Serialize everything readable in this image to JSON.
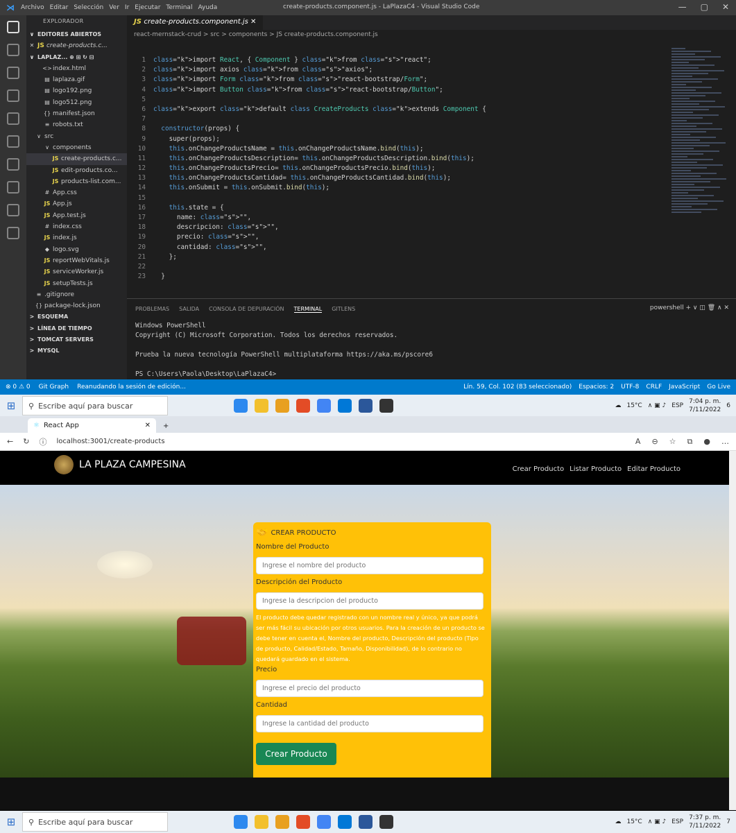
{
  "vscode": {
    "menu": [
      "Archivo",
      "Editar",
      "Selección",
      "Ver",
      "Ir",
      "Ejecutar",
      "Terminal",
      "Ayuda"
    ],
    "window_title": "create-products.component.js - LaPlazaC4 - Visual Studio Code",
    "explorer_title": "EXPLORADOR",
    "open_editors": "EDITORES ABIERTOS",
    "open_file": "create-products.c...",
    "project": "LAPLAZ...",
    "files": [
      {
        "icon": "<>",
        "name": "index.html",
        "indent": 1
      },
      {
        "icon": "▤",
        "name": "laplaza.gif",
        "indent": 1
      },
      {
        "icon": "▤",
        "name": "logo192.png",
        "indent": 1
      },
      {
        "icon": "▤",
        "name": "logo512.png",
        "indent": 1
      },
      {
        "icon": "{}",
        "name": "manifest.json",
        "indent": 1
      },
      {
        "icon": "≡",
        "name": "robots.txt",
        "indent": 1
      },
      {
        "icon": "∨",
        "name": "src",
        "indent": 0
      },
      {
        "icon": "∨",
        "name": "components",
        "indent": 1
      },
      {
        "icon": "JS",
        "name": "create-products.c...",
        "indent": 2,
        "selected": true
      },
      {
        "icon": "JS",
        "name": "edit-products.co...",
        "indent": 2
      },
      {
        "icon": "JS",
        "name": "products-list.com...",
        "indent": 2
      },
      {
        "icon": "#",
        "name": "App.css",
        "indent": 1
      },
      {
        "icon": "JS",
        "name": "App.js",
        "indent": 1
      },
      {
        "icon": "JS",
        "name": "App.test.js",
        "indent": 1
      },
      {
        "icon": "#",
        "name": "index.css",
        "indent": 1
      },
      {
        "icon": "JS",
        "name": "index.js",
        "indent": 1
      },
      {
        "icon": "◆",
        "name": "logo.svg",
        "indent": 1
      },
      {
        "icon": "JS",
        "name": "reportWebVitals.js",
        "indent": 1
      },
      {
        "icon": "JS",
        "name": "serviceWorker.js",
        "indent": 1
      },
      {
        "icon": "JS",
        "name": "setupTests.js",
        "indent": 1
      },
      {
        "icon": "≡",
        "name": ".gitignore",
        "indent": 0
      },
      {
        "icon": "{}",
        "name": "package-lock.json",
        "indent": 0
      }
    ],
    "sections": [
      "ESQUEMA",
      "LÍNEA DE TIEMPO",
      "TOMCAT SERVERS",
      "MYSQL"
    ],
    "tab": "create-products.component.js",
    "breadcrumb": "react-mernstack-crud > src > components > JS create-products.component.js",
    "code": [
      [
        1,
        "import React, { Component } from \"react\";"
      ],
      [
        2,
        "import axios from \"axios\";"
      ],
      [
        3,
        "import Form from \"react-bootstrap/Form\";"
      ],
      [
        4,
        "import Button from \"react-bootstrap/Button\";"
      ],
      [
        5,
        ""
      ],
      [
        6,
        "export default class CreateProducts extends Component {"
      ],
      [
        7,
        ""
      ],
      [
        8,
        "  constructor(props) {"
      ],
      [
        9,
        "    super(props);"
      ],
      [
        10,
        "    this.onChangeProductsName = this.onChangeProductsName.bind(this);"
      ],
      [
        11,
        "    this.onChangeProductsDescription= this.onChangeProductsDescription.bind(this);"
      ],
      [
        12,
        "    this.onChangeProductsPrecio= this.onChangeProductsPrecio.bind(this);"
      ],
      [
        13,
        "    this.onChangeProductsCantidad= this.onChangeProductsCantidad.bind(this);"
      ],
      [
        14,
        "    this.onSubmit = this.onSubmit.bind(this);"
      ],
      [
        15,
        ""
      ],
      [
        16,
        "    this.state = {"
      ],
      [
        17,
        "      name: \"\","
      ],
      [
        18,
        "      descripcion: \"\","
      ],
      [
        19,
        "      precio: \"\","
      ],
      [
        20,
        "      cantidad: \"\","
      ],
      [
        21,
        "    };"
      ],
      [
        22,
        ""
      ],
      [
        23,
        "  }"
      ]
    ],
    "panel_tabs": [
      "PROBLEMAS",
      "SALIDA",
      "CONSOLA DE DEPURACIÓN",
      "TERMINAL",
      "GITLENS"
    ],
    "terminal_name": "powershell",
    "terminal": "Windows PowerShell\nCopyright (C) Microsoft Corporation. Todos los derechos reservados.\n\nPrueba la nueva tecnología PowerShell multiplataforma https://aka.ms/pscore6\n\nPS C:\\Users\\Paola\\Desktop\\LaPlazaC4>",
    "status_left": [
      "⊗ 0 ⚠ 0",
      "Git Graph",
      "Reanudando la sesión de edición..."
    ],
    "status_right": [
      "Lín. 59, Col. 102 (83 seleccionado)",
      "Espacios: 2",
      "UTF-8",
      "CRLF",
      "JavaScript",
      "Go Live"
    ]
  },
  "taskbar_top": {
    "search": "Escribe aquí para buscar",
    "temp": "15°C",
    "lang": "ESP",
    "time": "7:04 p. m.",
    "date": "7/11/2022",
    "badge": "6"
  },
  "browser": {
    "tab_title": "React App",
    "url": "localhost:3001/create-products",
    "brand": "LA PLAZA CAMPESINA",
    "nav": [
      "Crear Producto",
      "Listar Producto",
      "Editar Producto"
    ],
    "form": {
      "title": "CREAR PRODUCTO",
      "name_label": "Nombre del Producto",
      "name_ph": "Ingrese el nombre del producto",
      "desc_label": "Descripción del Producto",
      "desc_ph": "Ingrese la descripcion del producto",
      "help": "El producto debe quedar registrado con un nombre real y único, ya que podrá ser más fácil su ubicación por otros usuarios. Para la creación de un producto se debe tener en cuenta el, Nombre del producto, Descripción del producto (Tipo de producto, Calidad/Estado, Tamaño, Disponibilidad), de lo contrario no quedará guardado en el sistema.",
      "price_label": "Precio",
      "price_ph": "Ingrese el precio del producto",
      "qty_label": "Cantidad",
      "qty_ph": "Ingrese la cantidad del producto",
      "submit": "Crear Producto"
    }
  },
  "taskbar_bottom": {
    "search": "Escribe aquí para buscar",
    "temp": "15°C",
    "lang": "ESP",
    "time": "7:37 p. m.",
    "date": "7/11/2022",
    "badge": "7"
  }
}
